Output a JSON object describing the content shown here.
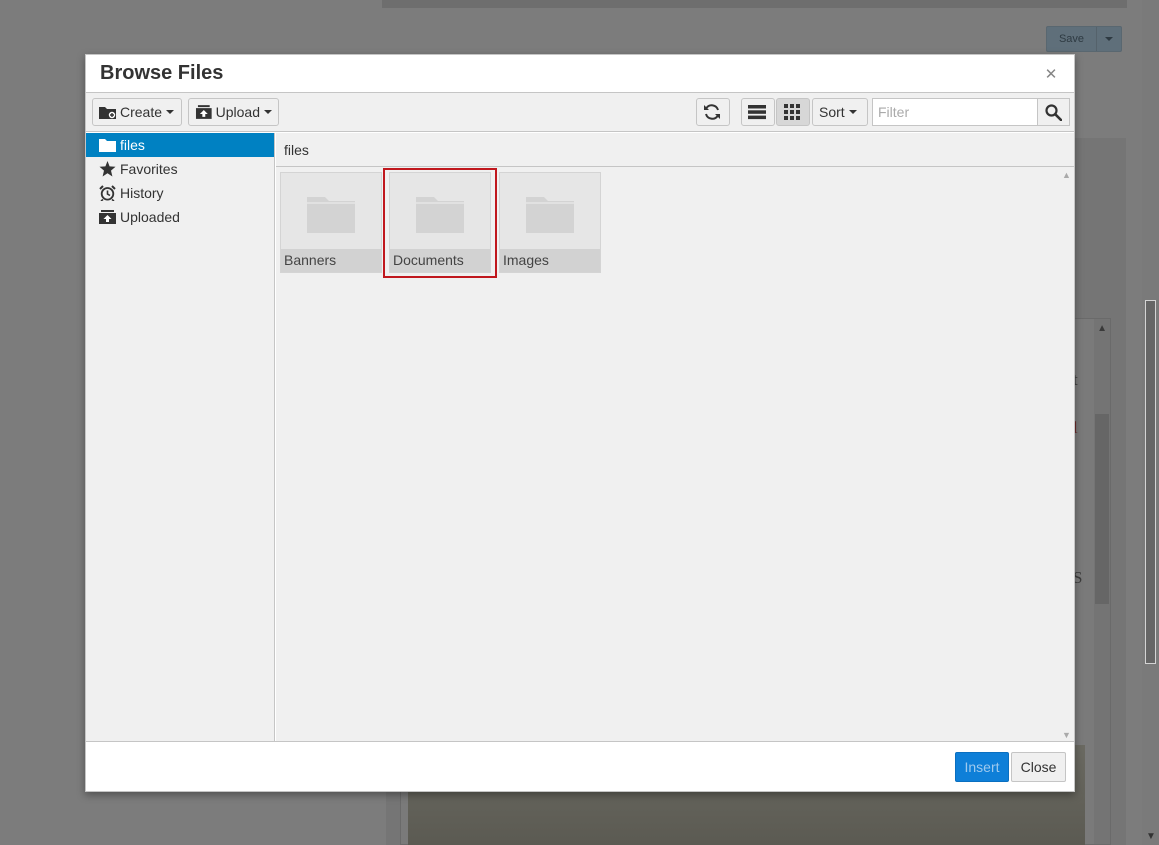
{
  "background": {
    "save_label": "Save",
    "text_fragments": [
      "t",
      "l",
      "S"
    ]
  },
  "dialog": {
    "title": "Browse Files",
    "close_glyph": "✕"
  },
  "toolbar": {
    "create_label": "Create",
    "upload_label": "Upload",
    "sort_label": "Sort",
    "filter_placeholder": "Filter",
    "filter_value": ""
  },
  "sidebar": {
    "items": [
      {
        "label": "files",
        "icon": "folder-icon",
        "selected": true
      },
      {
        "label": "Favorites",
        "icon": "star-icon",
        "selected": false
      },
      {
        "label": "History",
        "icon": "alarm-clock-icon",
        "selected": false
      },
      {
        "label": "Uploaded",
        "icon": "upload-box-icon",
        "selected": false
      }
    ]
  },
  "main": {
    "path": "files",
    "folders": [
      {
        "name": "Banners"
      },
      {
        "name": "Documents",
        "highlighted": true
      },
      {
        "name": "Images"
      }
    ]
  },
  "footer": {
    "insert_label": "Insert",
    "close_label": "Close"
  },
  "colors": {
    "selected": "#0081c2",
    "insert_button": "#0e7fd8",
    "highlight_border": "#c0171d"
  }
}
